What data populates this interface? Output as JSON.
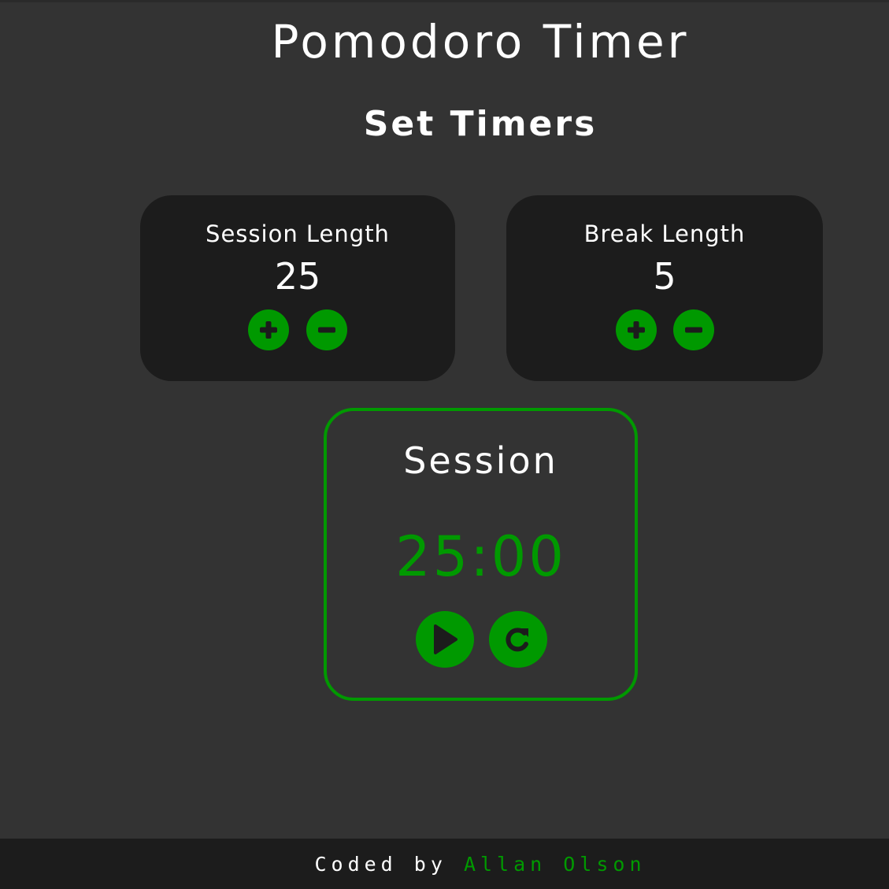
{
  "app": {
    "title": "Pomodoro Timer",
    "section_title": "Set Timers"
  },
  "colors": {
    "background": "#333333",
    "card": "#1c1c1c",
    "accent": "#009900",
    "text": "#ffffff"
  },
  "session_card": {
    "label": "Session Length",
    "value": "25",
    "increment_icon": "plus-icon",
    "decrement_icon": "minus-icon"
  },
  "break_card": {
    "label": "Break Length",
    "value": "5",
    "increment_icon": "plus-icon",
    "decrement_icon": "minus-icon"
  },
  "timer": {
    "label": "Session",
    "display": "25:00",
    "play_icon": "play-icon",
    "reset_icon": "reset-icon"
  },
  "footer": {
    "prefix": "Coded by",
    "author": "Allan Olson"
  }
}
